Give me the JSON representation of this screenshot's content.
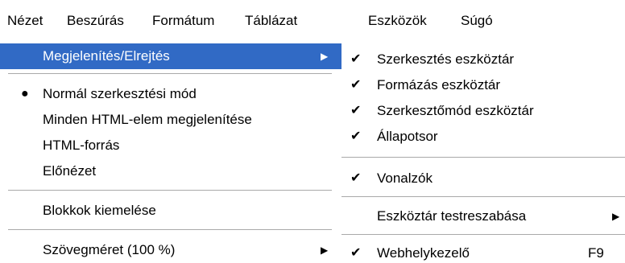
{
  "menubar": {
    "items": [
      {
        "label": "Nézet"
      },
      {
        "label": "Beszúrás"
      },
      {
        "label": "Formátum"
      },
      {
        "label": "Táblázat"
      },
      {
        "label": "Eszközök"
      },
      {
        "label": "Súgó"
      }
    ]
  },
  "view_menu": {
    "items": [
      {
        "label": "Megjelenítés/Elrejtés",
        "highlighted": true,
        "submenu_arrow": "▶"
      },
      {
        "label": "Normál szerkesztési mód",
        "bullet": "●"
      },
      {
        "label": "Minden HTML-elem megjelenítése"
      },
      {
        "label": "HTML-forrás"
      },
      {
        "label": "Előnézet"
      },
      {
        "label": "Blokkok kiemelése"
      },
      {
        "label": "Szövegméret (100 %)",
        "submenu_arrow": "▶"
      }
    ]
  },
  "show_hide_submenu": {
    "items": [
      {
        "label": "Szerkesztés eszköztár",
        "check": "✔"
      },
      {
        "label": "Formázás eszköztár",
        "check": "✔"
      },
      {
        "label": "Szerkesztőmód eszköztár",
        "check": "✔"
      },
      {
        "label": "Állapotsor",
        "check": "✔"
      },
      {
        "label": "Vonalzók",
        "check": "✔"
      },
      {
        "label": "Eszköztár testreszabása",
        "submenu_arrow": "▶"
      },
      {
        "label": "Webhelykezelő",
        "check": "✔",
        "shortcut": "F9"
      }
    ]
  },
  "colors": {
    "highlight_bg": "#316ac5",
    "highlight_text": "#ffffff",
    "separator": "#a9a9a9"
  }
}
